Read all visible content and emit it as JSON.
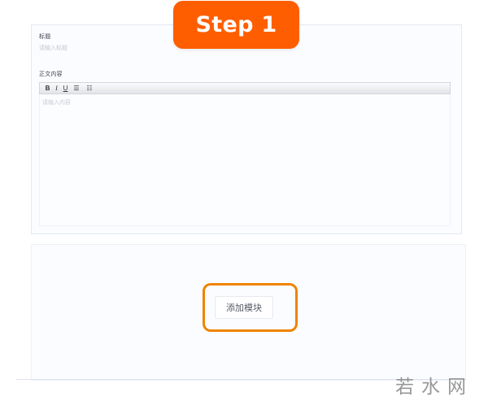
{
  "step_badge": {
    "label": "Step 1",
    "color": "#ff5e00"
  },
  "form": {
    "title_label": "标题",
    "title_placeholder": "请输入标题",
    "content_label": "正文内容",
    "content_placeholder": "请输入内容",
    "toolbar": {
      "bold": "B",
      "italic": "I",
      "underline": "U",
      "bullet_list": "☰",
      "ordered_list": "☷"
    }
  },
  "modules": {
    "add_module_label": "添加模块"
  },
  "highlight_color": "#f08300",
  "watermark": {
    "text": "若水网"
  }
}
